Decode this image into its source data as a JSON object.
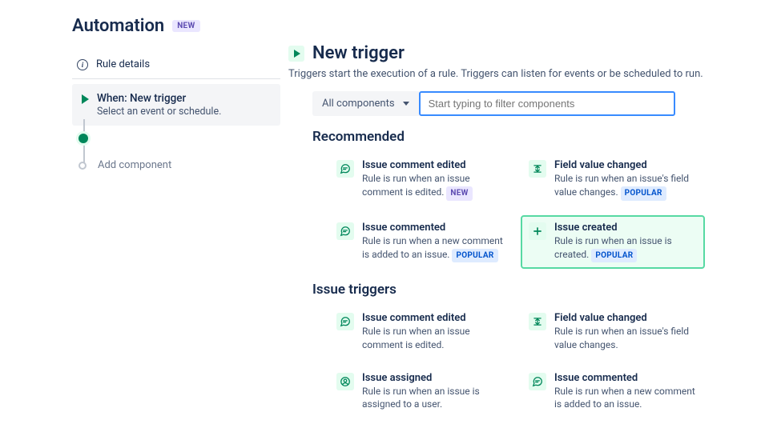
{
  "header": {
    "title": "Automation",
    "badge": "NEW"
  },
  "sidebar": {
    "rule_details": "Rule details",
    "step_title": "When: New trigger",
    "step_sub": "Select an event or schedule.",
    "add_component": "Add component"
  },
  "main": {
    "title": "New trigger",
    "description": "Triggers start the execution of a rule. Triggers can listen for events or be scheduled to run.",
    "dropdown_label": "All components",
    "search_placeholder": "Start typing to filter components",
    "sections": {
      "recommended": {
        "heading": "Recommended",
        "cards": [
          {
            "title": "Issue comment edited",
            "desc": "Rule is run when an issue comment is edited.",
            "tag": "NEW",
            "icon": "comment"
          },
          {
            "title": "Field value changed",
            "desc": "Rule is run when an issue's field value changes.",
            "tag": "POPULAR",
            "icon": "field"
          },
          {
            "title": "Issue commented",
            "desc": "Rule is run when a new comment is added to an issue.",
            "tag": "POPULAR",
            "icon": "comment"
          },
          {
            "title": "Issue created",
            "desc": "Rule is run when an issue is created.",
            "tag": "POPULAR",
            "icon": "plus",
            "selected": true
          }
        ]
      },
      "issue_triggers": {
        "heading": "Issue triggers",
        "cards": [
          {
            "title": "Issue comment edited",
            "desc": "Rule is run when an issue comment is edited.",
            "icon": "comment"
          },
          {
            "title": "Field value changed",
            "desc": "Rule is run when an issue's field value changes.",
            "icon": "field"
          },
          {
            "title": "Issue assigned",
            "desc": "Rule is run when an issue is assigned to a user.",
            "icon": "user"
          },
          {
            "title": "Issue commented",
            "desc": "Rule is run when a new comment is added to an issue.",
            "icon": "comment"
          }
        ]
      }
    }
  }
}
